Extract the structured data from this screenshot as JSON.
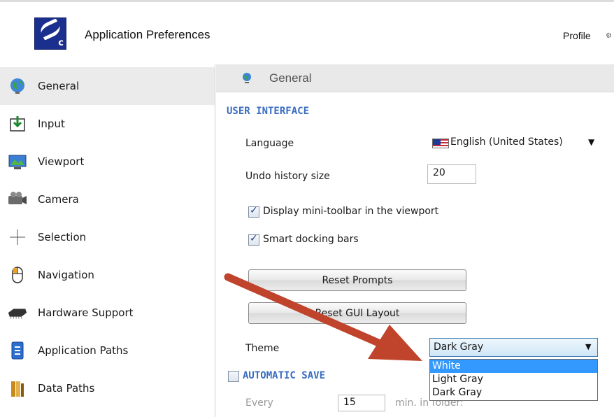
{
  "header": {
    "app_title": "Application Preferences",
    "logo_letter": "c",
    "profile_label": "Profile",
    "profile_icon": "gear-icon"
  },
  "sidebar": {
    "items": [
      {
        "label": "General",
        "icon": "globe-icon",
        "active": true
      },
      {
        "label": "Input",
        "icon": "input-icon"
      },
      {
        "label": "Viewport",
        "icon": "viewport-icon"
      },
      {
        "label": "Camera",
        "icon": "camera-icon"
      },
      {
        "label": "Selection",
        "icon": "crosshair-icon"
      },
      {
        "label": "Navigation",
        "icon": "mouse-icon"
      },
      {
        "label": "Hardware Support",
        "icon": "chip-icon"
      },
      {
        "label": "Application Paths",
        "icon": "application-paths-icon"
      },
      {
        "label": "Data Paths",
        "icon": "data-paths-icon"
      }
    ]
  },
  "content": {
    "title": "General",
    "user_interface": {
      "section_title": "USER INTERFACE",
      "language_label": "Language",
      "language_value": "English (United States)",
      "undo_label": "Undo history size",
      "undo_value": "20",
      "mini_toolbar_label": "Display mini-toolbar in the viewport",
      "mini_toolbar_checked": true,
      "smart_docking_label": "Smart docking bars",
      "smart_docking_checked": true,
      "reset_prompts_label": "Reset Prompts",
      "reset_gui_label": "Reset GUI Layout",
      "theme_label": "Theme",
      "theme_value": "Dark Gray",
      "theme_options": [
        "White",
        "Light Gray",
        "Dark Gray"
      ],
      "theme_highlighted": "White"
    },
    "automatic_save": {
      "section_title": "AUTOMATIC SAVE",
      "checked": false,
      "every_label": "Every",
      "every_value": "15",
      "suffix_label": "min. in folder:"
    }
  },
  "colors": {
    "section_title": "#3a6cc0",
    "annotation_arrow": "#c0442c",
    "dropdown_highlight": "#3399ff"
  }
}
